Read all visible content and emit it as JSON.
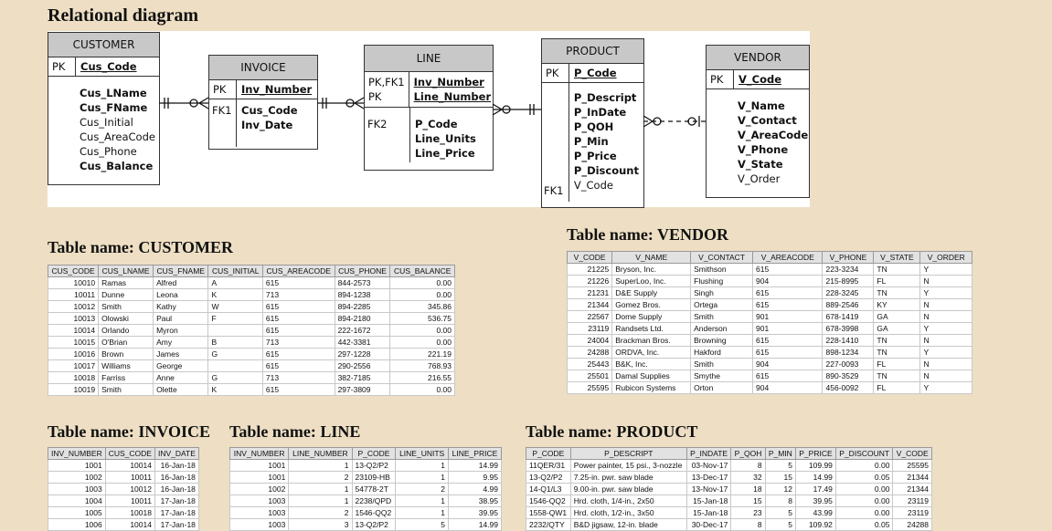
{
  "diagram_title": "Relational diagram",
  "entities": {
    "customer": {
      "name": "CUSTOMER",
      "pk_label": "PK",
      "pk": "Cus_Code",
      "attrs": [
        "Cus_LName",
        "Cus_FName",
        "Cus_Initial",
        "Cus_AreaCode",
        "Cus_Phone",
        "Cus_Balance"
      ]
    },
    "invoice": {
      "name": "INVOICE",
      "pk_label": "PK",
      "pk": "Inv_Number",
      "fk_label": "FK1",
      "attrs": [
        "Cus_Code",
        "Inv_Date"
      ]
    },
    "line": {
      "name": "LINE",
      "pk_label1": "PK,FK1",
      "pk_label2": "PK",
      "pk1": "Inv_Number",
      "pk2": "Line_Number",
      "fk_label": "FK2",
      "attrs": [
        "P_Code",
        "Line_Units",
        "Line_Price"
      ]
    },
    "product": {
      "name": "PRODUCT",
      "pk_label": "PK",
      "pk": "P_Code",
      "fk_label": "FK1",
      "attrs": [
        "P_Descript",
        "P_InDate",
        "P_QOH",
        "P_Min",
        "P_Price",
        "P_Discount",
        "V_Code"
      ]
    },
    "vendor": {
      "name": "VENDOR",
      "pk_label": "PK",
      "pk": "V_Code",
      "attrs": [
        "V_Name",
        "V_Contact",
        "V_AreaCode",
        "V_Phone",
        "V_State",
        "V_Order"
      ]
    }
  },
  "tables": {
    "customer": {
      "title": "Table name: CUSTOMER",
      "columns": [
        "CUS_CODE",
        "CUS_LNAME",
        "CUS_FNAME",
        "CUS_INITIAL",
        "CUS_AREACODE",
        "CUS_PHONE",
        "CUS_BALANCE"
      ],
      "align": [
        "r",
        "l",
        "l",
        "l",
        "l",
        "l",
        "r"
      ],
      "rows": [
        [
          "10010",
          "Ramas",
          "Alfred",
          "A",
          "615",
          "844-2573",
          "0.00"
        ],
        [
          "10011",
          "Dunne",
          "Leona",
          "K",
          "713",
          "894-1238",
          "0.00"
        ],
        [
          "10012",
          "Smith",
          "Kathy",
          "W",
          "615",
          "894-2285",
          "345.86"
        ],
        [
          "10013",
          "Olowski",
          "Paul",
          "F",
          "615",
          "894-2180",
          "536.75"
        ],
        [
          "10014",
          "Orlando",
          "Myron",
          "",
          "615",
          "222-1672",
          "0.00"
        ],
        [
          "10015",
          "O'Brian",
          "Amy",
          "B",
          "713",
          "442-3381",
          "0.00"
        ],
        [
          "10016",
          "Brown",
          "James",
          "G",
          "615",
          "297-1228",
          "221.19"
        ],
        [
          "10017",
          "Williams",
          "George",
          "",
          "615",
          "290-2556",
          "768.93"
        ],
        [
          "10018",
          "Farriss",
          "Anne",
          "G",
          "713",
          "382-7185",
          "216.55"
        ],
        [
          "10019",
          "Smith",
          "Olette",
          "K",
          "615",
          "297-3809",
          "0.00"
        ]
      ]
    },
    "vendor": {
      "title": "Table name: VENDOR",
      "columns": [
        "V_CODE",
        "V_NAME",
        "V_CONTACT",
        "V_AREACODE",
        "V_PHONE",
        "V_STATE",
        "V_ORDER"
      ],
      "align": [
        "r",
        "l",
        "l",
        "l",
        "l",
        "l",
        "l"
      ],
      "rows": [
        [
          "21225",
          "Bryson, Inc.",
          "Smithson",
          "615",
          "223-3234",
          "TN",
          "Y"
        ],
        [
          "21226",
          "SuperLoo, Inc.",
          "Flushing",
          "904",
          "215-8995",
          "FL",
          "N"
        ],
        [
          "21231",
          "D&E Supply",
          "Singh",
          "615",
          "228-3245",
          "TN",
          "Y"
        ],
        [
          "21344",
          "Gomez Bros.",
          "Ortega",
          "615",
          "889-2546",
          "KY",
          "N"
        ],
        [
          "22567",
          "Dome Supply",
          "Smith",
          "901",
          "678-1419",
          "GA",
          "N"
        ],
        [
          "23119",
          "Randsets Ltd.",
          "Anderson",
          "901",
          "678-3998",
          "GA",
          "Y"
        ],
        [
          "24004",
          "Brackman Bros.",
          "Browning",
          "615",
          "228-1410",
          "TN",
          "N"
        ],
        [
          "24288",
          "ORDVA, Inc.",
          "Hakford",
          "615",
          "898-1234",
          "TN",
          "Y"
        ],
        [
          "25443",
          "B&K, Inc.",
          "Smith",
          "904",
          "227-0093",
          "FL",
          "N"
        ],
        [
          "25501",
          "Damal Supplies",
          "Smythe",
          "615",
          "890-3529",
          "TN",
          "N"
        ],
        [
          "25595",
          "Rubicon Systems",
          "Orton",
          "904",
          "456-0092",
          "FL",
          "Y"
        ]
      ]
    },
    "invoice": {
      "title": "Table name: INVOICE",
      "columns": [
        "INV_NUMBER",
        "CUS_CODE",
        "INV_DATE"
      ],
      "align": [
        "r",
        "r",
        "r"
      ],
      "rows": [
        [
          "1001",
          "10014",
          "16-Jan-18"
        ],
        [
          "1002",
          "10011",
          "16-Jan-18"
        ],
        [
          "1003",
          "10012",
          "16-Jan-18"
        ],
        [
          "1004",
          "10011",
          "17-Jan-18"
        ],
        [
          "1005",
          "10018",
          "17-Jan-18"
        ],
        [
          "1006",
          "10014",
          "17-Jan-18"
        ]
      ]
    },
    "line": {
      "title": "Table name: LINE",
      "columns": [
        "INV_NUMBER",
        "LINE_NUMBER",
        "P_CODE",
        "LINE_UNITS",
        "LINE_PRICE"
      ],
      "align": [
        "r",
        "r",
        "l",
        "r",
        "r"
      ],
      "rows": [
        [
          "1001",
          "1",
          "13-Q2/P2",
          "1",
          "14.99"
        ],
        [
          "1001",
          "2",
          "23109-HB",
          "1",
          "9.95"
        ],
        [
          "1002",
          "1",
          "54778-2T",
          "2",
          "4.99"
        ],
        [
          "1003",
          "1",
          "2238/QPD",
          "1",
          "38.95"
        ],
        [
          "1003",
          "2",
          "1546-QQ2",
          "1",
          "39.95"
        ],
        [
          "1003",
          "3",
          "13-Q2/P2",
          "5",
          "14.99"
        ]
      ]
    },
    "product": {
      "title": "Table name: PRODUCT",
      "columns": [
        "P_CODE",
        "P_DESCRIPT",
        "P_INDATE",
        "P_QOH",
        "P_MIN",
        "P_PRICE",
        "P_DISCOUNT",
        "V_CODE"
      ],
      "align": [
        "l",
        "l",
        "r",
        "r",
        "r",
        "r",
        "r",
        "r"
      ],
      "rows": [
        [
          "11QER/31",
          "Power painter, 15 psi., 3-nozzle",
          "03-Nov-17",
          "8",
          "5",
          "109.99",
          "0.00",
          "25595"
        ],
        [
          "13-Q2/P2",
          "7.25-in. pwr. saw blade",
          "13-Dec-17",
          "32",
          "15",
          "14.99",
          "0.05",
          "21344"
        ],
        [
          "14-Q1/L3",
          "9.00-in. pwr. saw blade",
          "13-Nov-17",
          "18",
          "12",
          "17.49",
          "0.00",
          "21344"
        ],
        [
          "1546-QQ2",
          "Hrd. cloth, 1/4-in., 2x50",
          "15-Jan-18",
          "15",
          "8",
          "39.95",
          "0.00",
          "23119"
        ],
        [
          "1558-QW1",
          "Hrd. cloth, 1/2-in., 3x50",
          "15-Jan-18",
          "23",
          "5",
          "43.99",
          "0.00",
          "23119"
        ],
        [
          "2232/QTY",
          "B&D jigsaw, 12-in. blade",
          "30-Dec-17",
          "8",
          "5",
          "109.92",
          "0.05",
          "24288"
        ]
      ]
    }
  },
  "colors": {
    "page_bg": "#eedfc4",
    "header_gray": "#c8c8c8",
    "table_header": "#e2e2e2"
  }
}
